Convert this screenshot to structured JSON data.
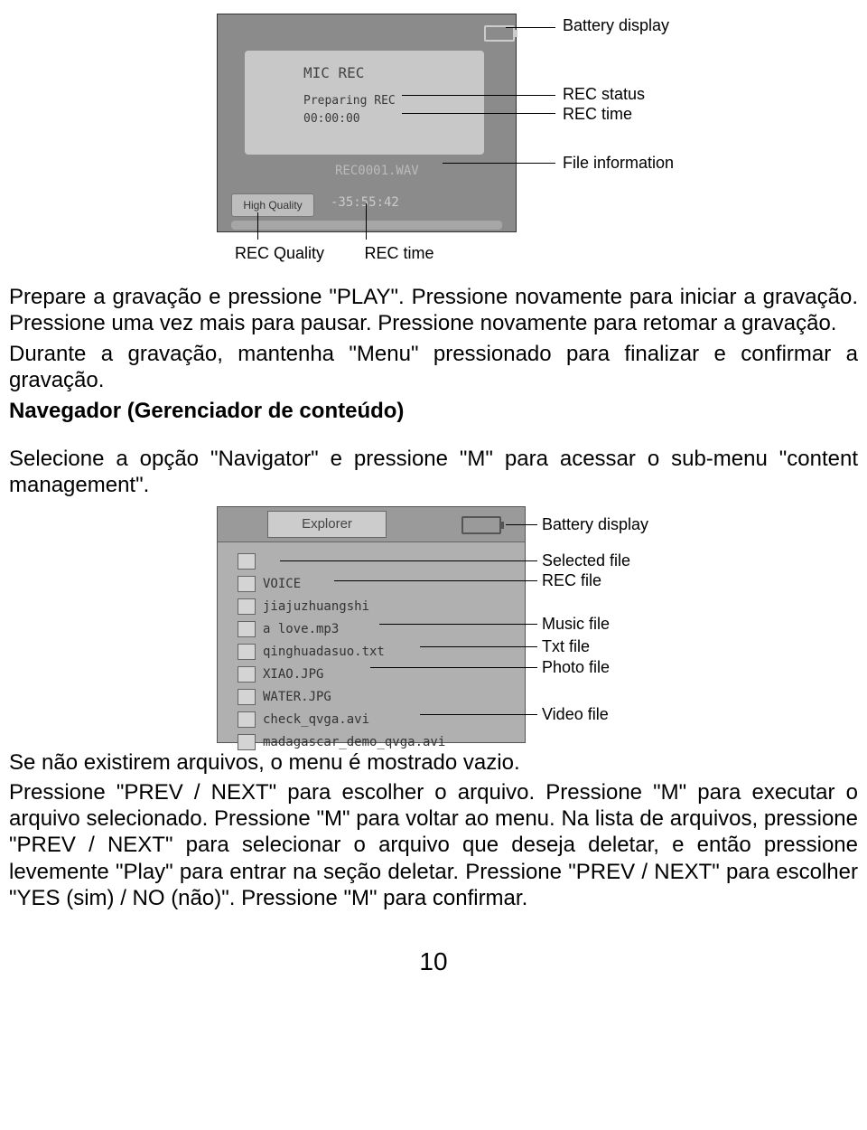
{
  "fig1": {
    "device": {
      "title": "MIC REC",
      "status": "Preparing REC",
      "time": "00:00:00",
      "file": "REC0001.WAV",
      "quality": "High Quality",
      "remain": "-35:55:42"
    },
    "callouts": {
      "battery": "Battery display",
      "rec_status": "REC status",
      "rec_time": "REC time",
      "file_info": "File information",
      "rec_quality": "REC Quality",
      "rec_time2": "REC time"
    }
  },
  "para1": "Prepare a gravação e pressione \"PLAY\". Pressione novamente para iniciar a gravação. Pressione uma vez mais para pausar. Pressione novamente para retomar a gravação.",
  "para2": "Durante a gravação, mantenha \"Menu\" pressionado para finalizar e confirmar a gravação.",
  "heading": "Navegador (Gerenciador de conteúdo)",
  "para3": "Selecione a opção \"Navigator\" e pressione \"M\" para acessar o sub-menu \"content management\".",
  "fig2": {
    "tab": "Explorer",
    "rows": [
      "",
      "VOICE",
      "jiajuzhuangshi",
      "a love.mp3",
      "qinghuadasuo.txt",
      "XIAO.JPG",
      "WATER.JPG",
      "check_qvga.avi",
      "madagascar_demo_qvga.avi"
    ],
    "callouts": {
      "battery": "Battery display",
      "selected": "Selected file",
      "rec": "REC file",
      "music": "Music file",
      "txt": "Txt file",
      "photo": "Photo file",
      "video": "Video file"
    }
  },
  "para4": "Se não existirem arquivos, o menu é mostrado vazio.",
  "para5": "Pressione \"PREV / NEXT\" para escolher o arquivo. Pressione \"M\" para executar o arquivo selecionado. Pressione \"M\" para voltar ao menu. Na lista de arquivos, pressione \"PREV / NEXT\" para selecionar o arquivo que deseja deletar, e então pressione levemente \"Play\" para entrar na seção deletar. Pressione \"PREV / NEXT\" para escolher \"YES (sim) / NO (não)\". Pressione \"M\" para confirmar.",
  "page_number": "10"
}
